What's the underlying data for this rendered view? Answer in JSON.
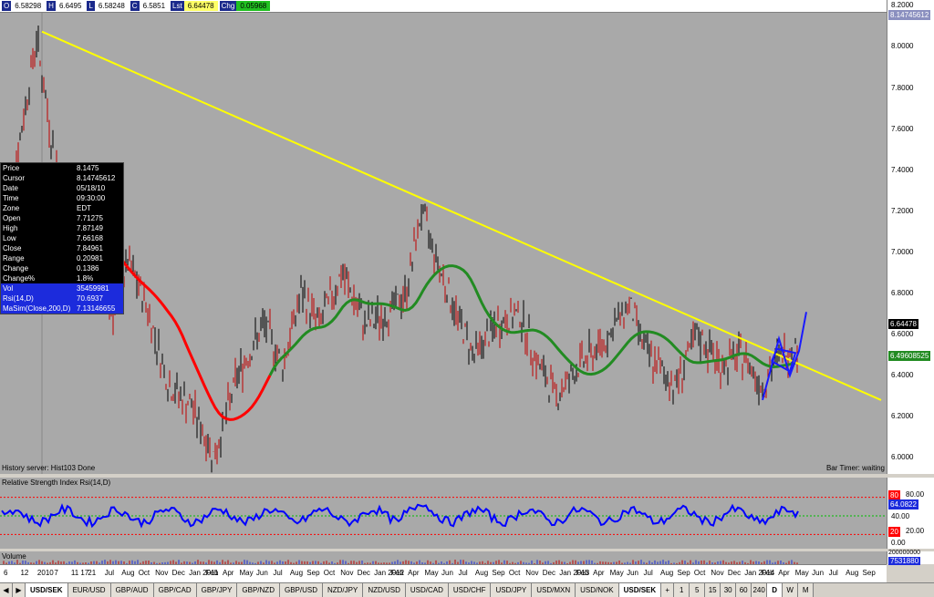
{
  "quote": {
    "o_key": "O",
    "o_val": "6.58298",
    "h_key": "H",
    "h_val": "6.6495",
    "l_key": "L",
    "l_val": "6.58248",
    "c_key": "C",
    "c_val": "6.5851",
    "lst_key": "Lst",
    "lst_val": "6.64478",
    "chg_key": "Chg",
    "chg_val": "0.05968"
  },
  "price_axis": {
    "ticks": [
      "8.2000",
      "8.0000",
      "7.8000",
      "7.6000",
      "7.4000",
      "7.2000",
      "7.0000",
      "6.8000",
      "6.6000",
      "6.4000",
      "6.2000",
      "6.0000"
    ],
    "cursor_tag": "8.14745612",
    "last_tag": "6.64478",
    "ma_tag": "6.49608525"
  },
  "data_window": [
    {
      "k": "Price",
      "v": "8.1475"
    },
    {
      "k": "Cursor",
      "v": "8.14745612"
    },
    {
      "k": "Date",
      "v": "05/18/10"
    },
    {
      "k": "Time",
      "v": "09:30:00"
    },
    {
      "k": "Zone",
      "v": "EDT"
    },
    {
      "k": "Open",
      "v": "7.71275"
    },
    {
      "k": "High",
      "v": "7.87149"
    },
    {
      "k": "Low",
      "v": "7.66168"
    },
    {
      "k": "Close",
      "v": "7.84961"
    },
    {
      "k": "Range",
      "v": "0.20981"
    },
    {
      "k": "Change",
      "v": "0.1386"
    },
    {
      "k": "Change%",
      "v": "1.8%"
    },
    {
      "k": "Vol",
      "v": "35459981"
    },
    {
      "k": "Rsi(14,D)",
      "v": "70.6937"
    },
    {
      "k": "MaSim(Close,200,D)",
      "v": "7.13146655"
    }
  ],
  "status": {
    "left": "History server: Hist103 Done",
    "right": "Bar Timer: waiting"
  },
  "rsi": {
    "title": "Relative Strength Index Rsi(14,D)",
    "ticks": [
      "80.00",
      "40.00",
      "20.00",
      "0.00"
    ],
    "tag_upper": "80",
    "tag_value": "64.0822",
    "tag_lower": "20"
  },
  "volume": {
    "title": "Volume",
    "tick": "200000000",
    "tag": "7531880"
  },
  "time_axis": {
    "labels": [
      "6",
      "12",
      "2010",
      "7",
      "11 17",
      "21",
      "Jul",
      "Aug",
      "Oct",
      "Nov",
      "Dec",
      "Jan 2011",
      "Feb",
      "Apr",
      "May",
      "Jun",
      "Jul",
      "Aug",
      "Sep",
      "Oct",
      "Nov",
      "Dec",
      "Jan 2012",
      "Feb",
      "Apr",
      "May",
      "Jun",
      "Jul",
      "Aug",
      "Sep",
      "Oct",
      "Nov",
      "Dec",
      "Jan 2013",
      "Feb",
      "Apr",
      "May",
      "Jun",
      "Jul",
      "Aug",
      "Sep",
      "Oct",
      "Nov",
      "Dec",
      "Jan 2014",
      "Feb",
      "Apr",
      "May",
      "Jun",
      "Jul",
      "Aug",
      "Sep"
    ]
  },
  "tabs": [
    "USD/SEK",
    "EUR/USD",
    "GBP/AUD",
    "GBP/CAD",
    "GBP/JPY",
    "GBP/NZD",
    "GBP/USD",
    "NZD/JPY",
    "NZD/USD",
    "USD/CAD",
    "USD/CHF",
    "USD/JPY",
    "USD/MXN",
    "USD/NOK",
    "USD/SEK"
  ],
  "active_tab": "USD/SEK",
  "periods": [
    "1",
    "5",
    "15",
    "30",
    "60",
    "240",
    "D",
    "W",
    "M"
  ],
  "active_period": "D",
  "colors": {
    "trendline": "#ffff00",
    "ma": "#228b22",
    "ma_above": "#ff0000",
    "rsi": "#0000ff",
    "pattern": "#1a1aff"
  }
}
